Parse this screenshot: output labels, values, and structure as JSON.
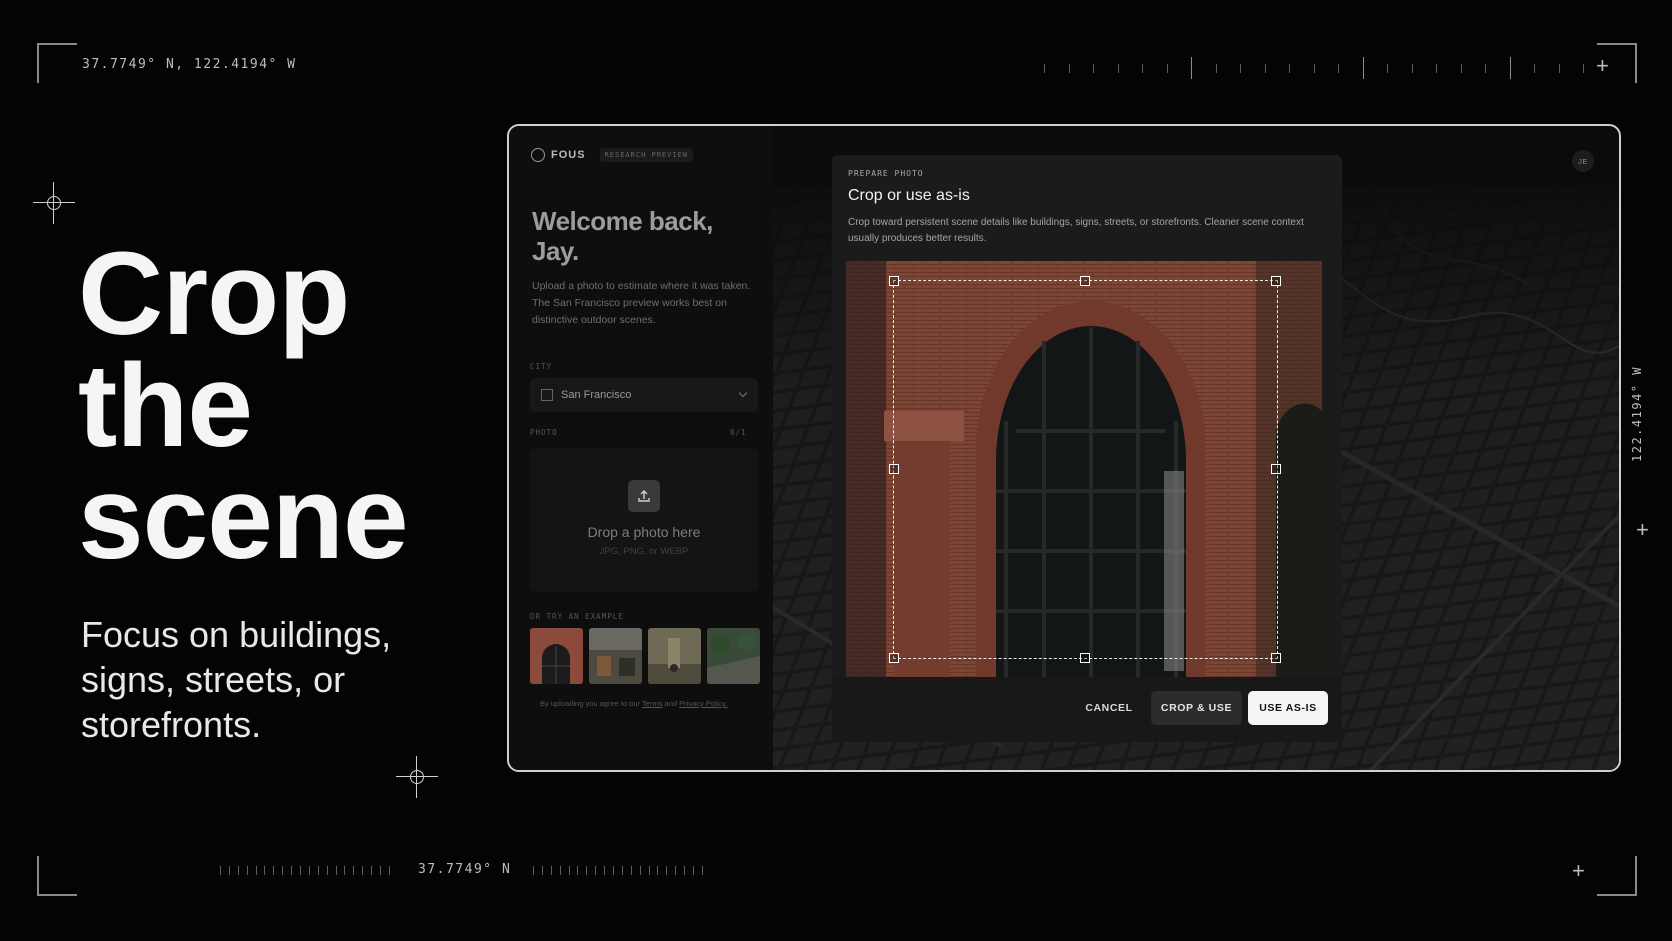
{
  "overlay": {
    "coord_top_left": "37.7749° N, 122.4194° W",
    "coord_bottom": "37.7749° N",
    "coord_right_vertical": "122.4194° W"
  },
  "hero": {
    "title_lines": [
      "Crop",
      "the",
      "scene"
    ],
    "subtitle": "Focus on buildings, signs, streets, or storefronts."
  },
  "app": {
    "brand_name": "FOUS",
    "brand_badge": "RESEARCH PREVIEW",
    "avatar_initials": "JE",
    "welcome_title": "Welcome back, Jay.",
    "welcome_text": "Upload a photo to estimate where it was taken. The San Francisco preview works best on distinctive outdoor scenes.",
    "city_label": "CITY",
    "city_value": "San Francisco",
    "photo_label": "PHOTO",
    "photo_count": "0/1",
    "drop_title": "Drop a photo here",
    "drop_sub": "JPG, PNG, or WEBP",
    "examples_label": "OR TRY AN EXAMPLE",
    "terms_prefix": "By uploading you agree to our",
    "terms_link": "Terms",
    "terms_and": "and",
    "privacy_link": "Privacy Policy."
  },
  "modal": {
    "eyebrow": "PREPARE PHOTO",
    "title": "Crop or use as-is",
    "description": "Crop toward persistent scene details like buildings, signs, streets, or storefronts. Cleaner scene context usually produces better results.",
    "cancel_label": "CANCEL",
    "crop_label": "CROP & USE",
    "use_label": "USE AS-IS"
  },
  "colors": {
    "background": "#040404",
    "panel": "#1b1b1b",
    "primary_button": "#f5f5f5",
    "brick": "#8b4a3a"
  }
}
